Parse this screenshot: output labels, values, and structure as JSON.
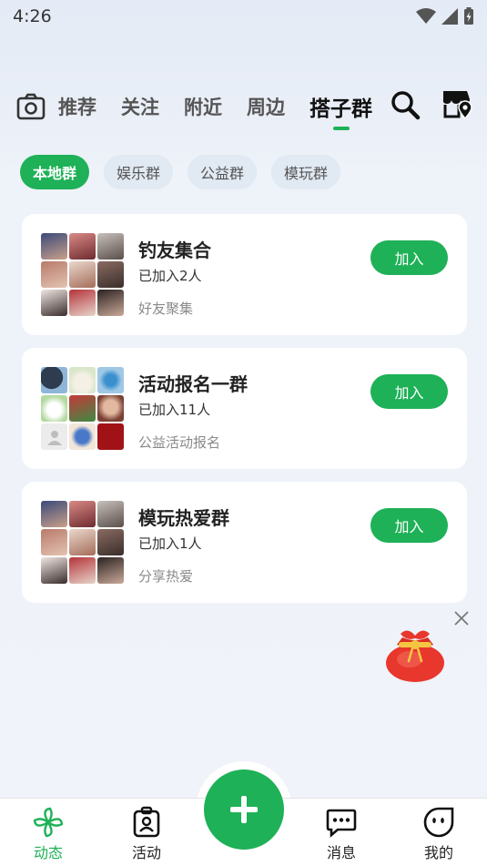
{
  "status_bar": {
    "time": "4:26"
  },
  "top_nav": {
    "tabs": [
      "推荐",
      "关注",
      "附近",
      "周边",
      "搭子群"
    ],
    "active_tab": "搭子群"
  },
  "chips": [
    "本地群",
    "娱乐群",
    "公益群",
    "模玩群"
  ],
  "groups": [
    {
      "name": "钓友集合",
      "count": "已加入2人",
      "desc": "好友聚集",
      "join_label": "加入"
    },
    {
      "name": "活动报名一群",
      "count": "已加入11人",
      "desc": "公益活动报名",
      "join_label": "加入"
    },
    {
      "name": "模玩热爱群",
      "count": "已加入1人",
      "desc": "分享热爱",
      "join_label": "加入"
    }
  ],
  "bottom_nav": {
    "items": [
      {
        "label": "动态",
        "icon": "pinwheel-icon"
      },
      {
        "label": "活动",
        "icon": "badge-icon"
      },
      {
        "label": "消息",
        "icon": "chat-icon"
      },
      {
        "label": "我的",
        "icon": "face-icon"
      }
    ]
  },
  "colors": {
    "accent": "#1eb157",
    "background": "#eef2f9"
  }
}
